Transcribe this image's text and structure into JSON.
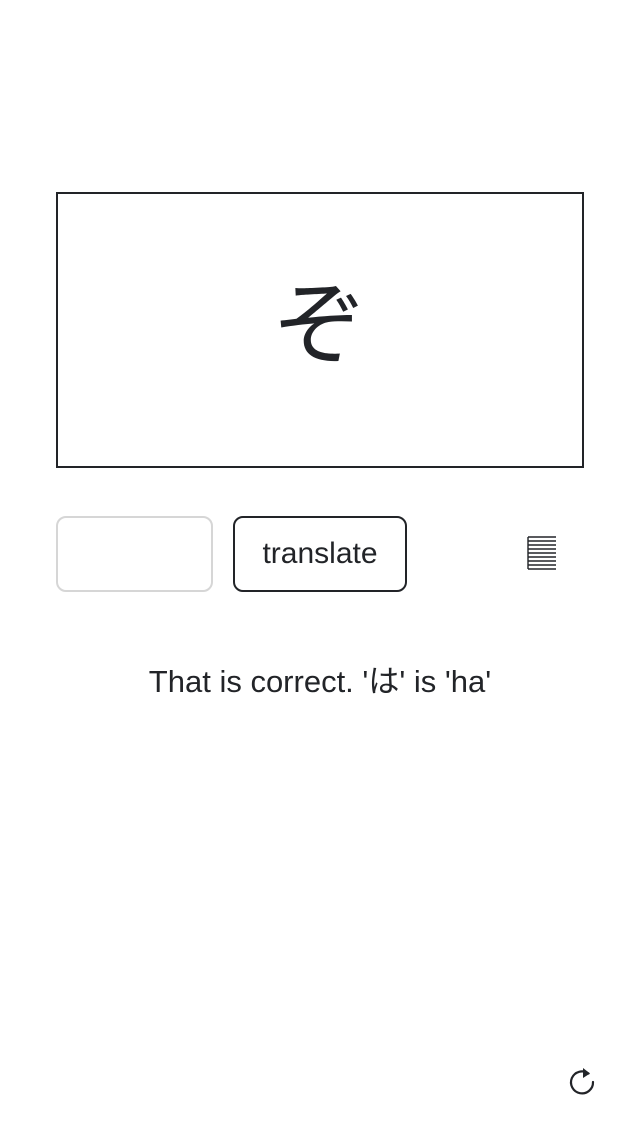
{
  "flashcard": {
    "character": "ぞ"
  },
  "controls": {
    "answer_value": "",
    "answer_placeholder": "",
    "translate_label": "translate",
    "list_icon": "list-justify-icon"
  },
  "feedback": {
    "text": "That is correct. 'は' is 'ha'"
  },
  "footer": {
    "refresh_icon": "refresh-icon"
  },
  "colors": {
    "text": "#222428",
    "input_border": "#d6d6d6",
    "background": "#ffffff"
  }
}
